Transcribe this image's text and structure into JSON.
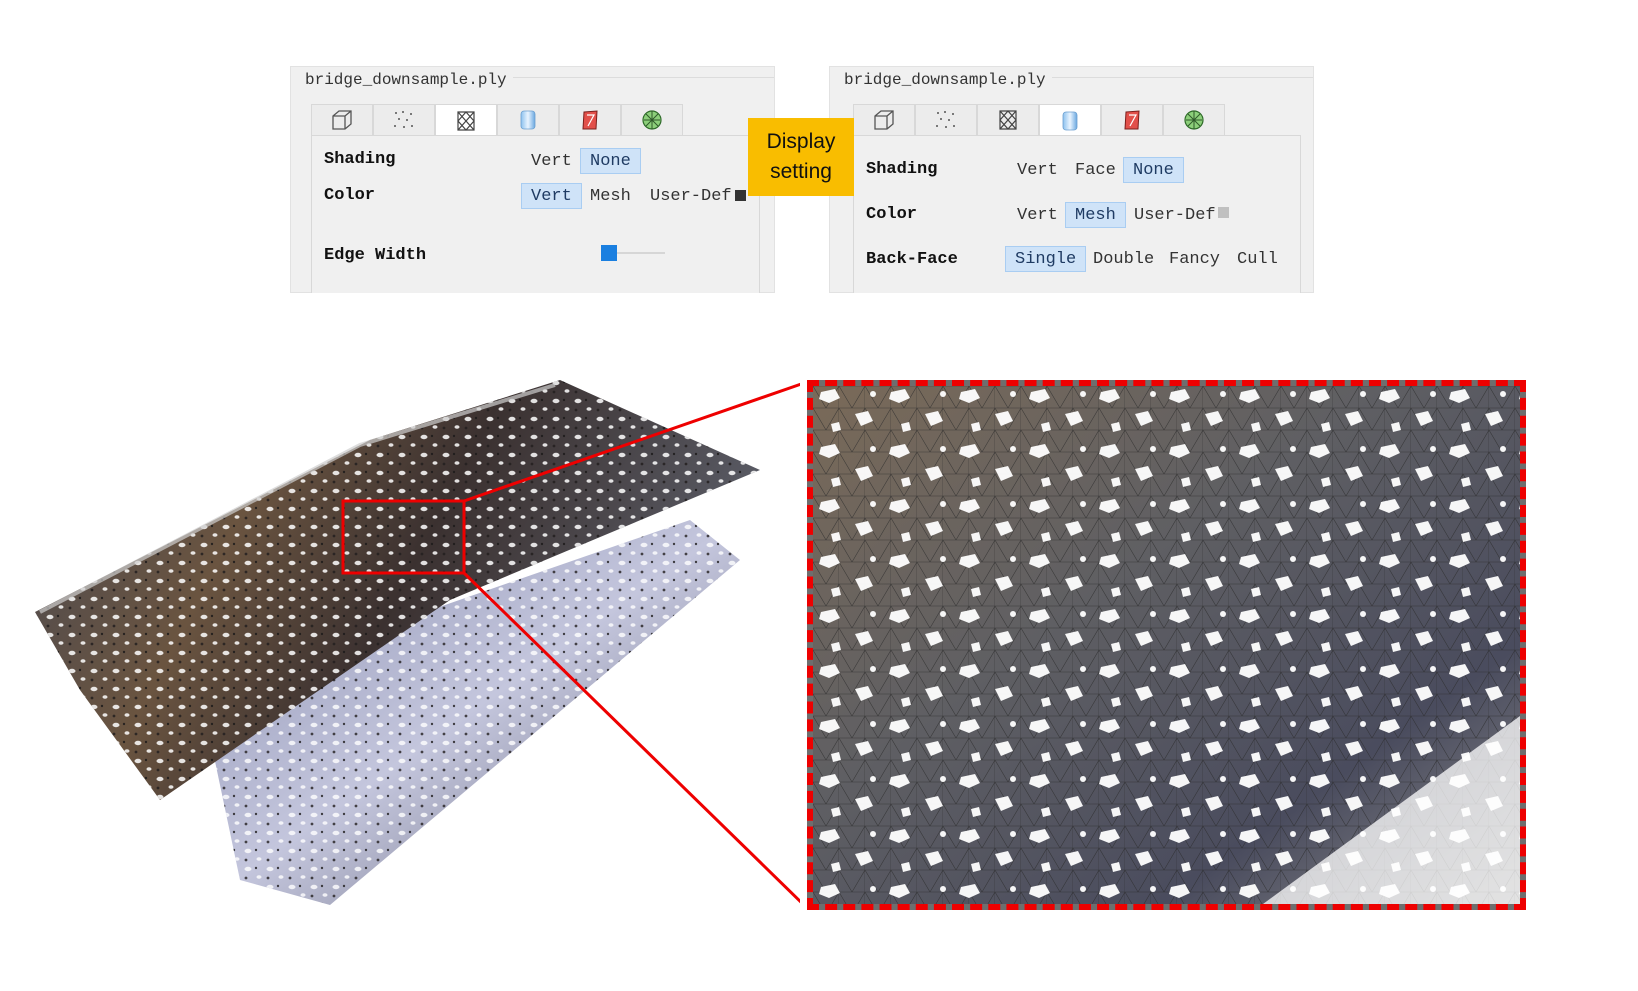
{
  "left_panel": {
    "title": "bridge_downsample.ply",
    "tabs": [
      "box-icon",
      "points-icon",
      "wireframe-icon",
      "cylinder-icon",
      "red-box-icon",
      "green-mesh-icon"
    ],
    "active_tab": 2,
    "shading_label": "Shading",
    "shading_options": [
      "Vert",
      "None"
    ],
    "shading_selected": "None",
    "color_label": "Color",
    "color_options": [
      "Vert",
      "Mesh",
      "User-Def"
    ],
    "color_selected": "Vert",
    "user_def_color": "#333333",
    "edge_width_label": "Edge Width"
  },
  "right_panel": {
    "title": "bridge_downsample.ply",
    "tabs": [
      "box-icon",
      "points-icon",
      "wireframe-icon",
      "cylinder-icon",
      "red-box-icon",
      "green-mesh-icon"
    ],
    "active_tab": 3,
    "shading_label": "Shading",
    "shading_options": [
      "Vert",
      "Face",
      "None"
    ],
    "shading_selected": "None",
    "color_label": "Color",
    "color_options": [
      "Vert",
      "Mesh",
      "User-Def"
    ],
    "color_selected": "Mesh",
    "user_def_color": "#c0c0c0",
    "backface_label": "Back-Face",
    "backface_options": [
      "Single",
      "Double",
      "Fancy",
      "Cull"
    ],
    "backface_selected": "Single"
  },
  "callout": {
    "line1": "Display",
    "line2": "setting",
    "color": "#f9bd00"
  },
  "highlight_color": "#ee0000"
}
